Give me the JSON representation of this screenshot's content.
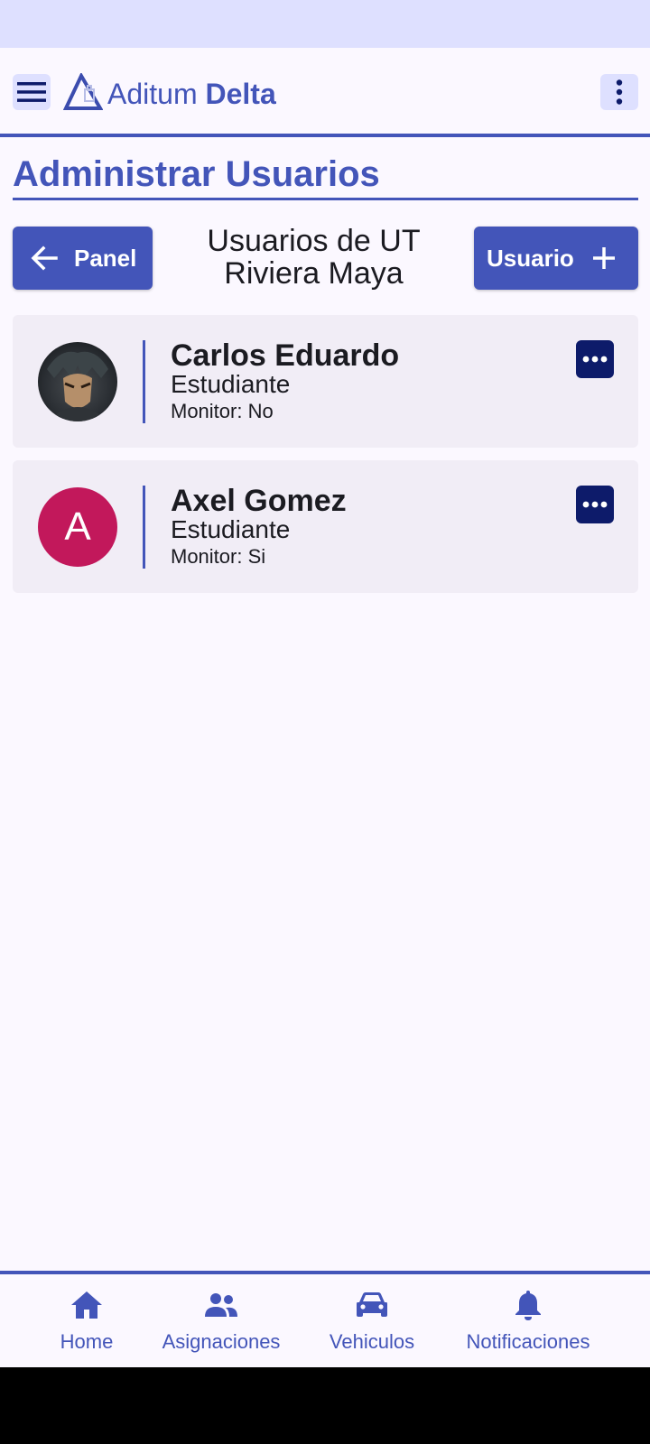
{
  "colors": {
    "primary": "#4355b9",
    "primary_container": "#dee0ff",
    "card_background": "#f1edf6",
    "more_button": "#0d1b6a",
    "avatar_letter_background": "#c2185b"
  },
  "header": {
    "brand_light": "Aditum",
    "brand_bold": "Delta",
    "menu_icon": "hamburger-menu-icon",
    "overflow_icon": "more-vertical-icon"
  },
  "page": {
    "title": "Administrar Usuarios",
    "heading": "Usuarios de UT Riviera Maya"
  },
  "actions": {
    "back_label": "Panel",
    "back_icon": "arrow-left-icon",
    "add_label": "Usuario",
    "add_icon": "plus-icon"
  },
  "users": [
    {
      "name": "Carlos Eduardo",
      "role": "Estudiante",
      "monitor": "Monitor: No",
      "avatar": "photo"
    },
    {
      "name": "Axel Gomez",
      "role": "Estudiante",
      "monitor": "Monitor: Si",
      "avatar_letter": "A"
    }
  ],
  "bottom_nav": [
    {
      "label": "Home",
      "icon": "home-icon"
    },
    {
      "label": "Asignaciones",
      "icon": "people-icon"
    },
    {
      "label": "Vehiculos",
      "icon": "car-icon"
    },
    {
      "label": "Notificaciones",
      "icon": "bell-icon"
    }
  ]
}
